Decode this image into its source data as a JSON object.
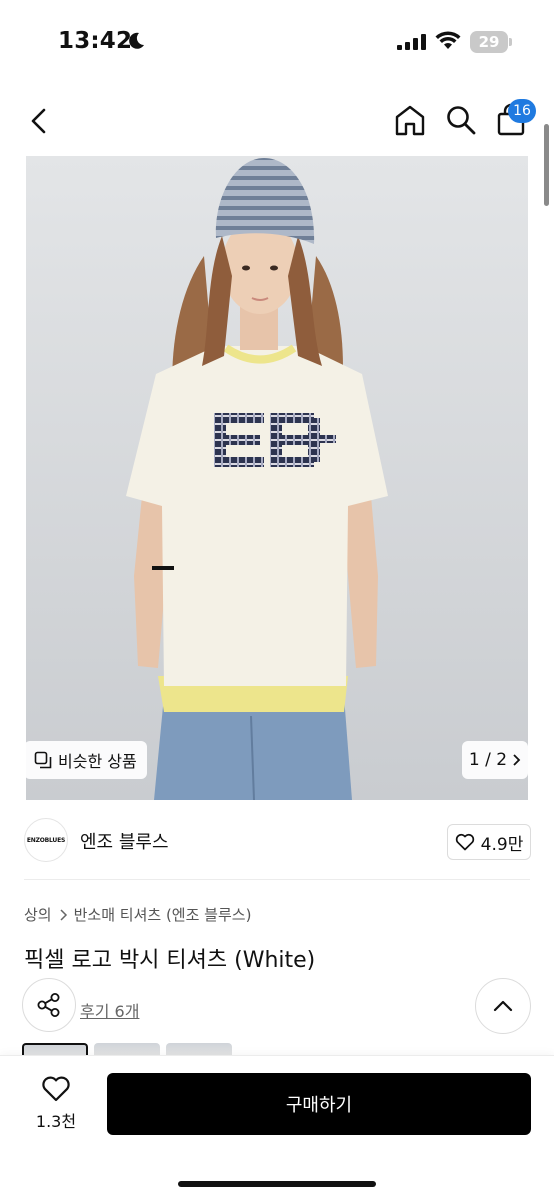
{
  "status_bar": {
    "time": "13:42",
    "battery": "29",
    "icons": [
      "moon-icon",
      "signal-icon",
      "wifi-icon",
      "battery-icon"
    ]
  },
  "nav": {
    "icons": [
      "back-icon",
      "home-icon",
      "search-icon",
      "cart-icon"
    ],
    "cart_badge": "16"
  },
  "gallery": {
    "similar_label": "비슷한 상품",
    "pager": "1 / 2",
    "shirt_logo": "EB"
  },
  "brand": {
    "logo_text": "ENZOBLUES",
    "name": "엔조 블루스",
    "likes": "4.9만"
  },
  "product": {
    "breadcrumb": [
      "상의",
      "반소매 티셔츠 (엔조 블루스)"
    ],
    "title": "픽셀 로고 박시 티셔츠 (White)",
    "reviews_label": "후기 6개"
  },
  "bottom_bar": {
    "wish_count": "1.3천",
    "buy_label": "구매하기"
  },
  "colors": {
    "accent_badge": "#1f7ae0",
    "buy_button": "#000000"
  }
}
